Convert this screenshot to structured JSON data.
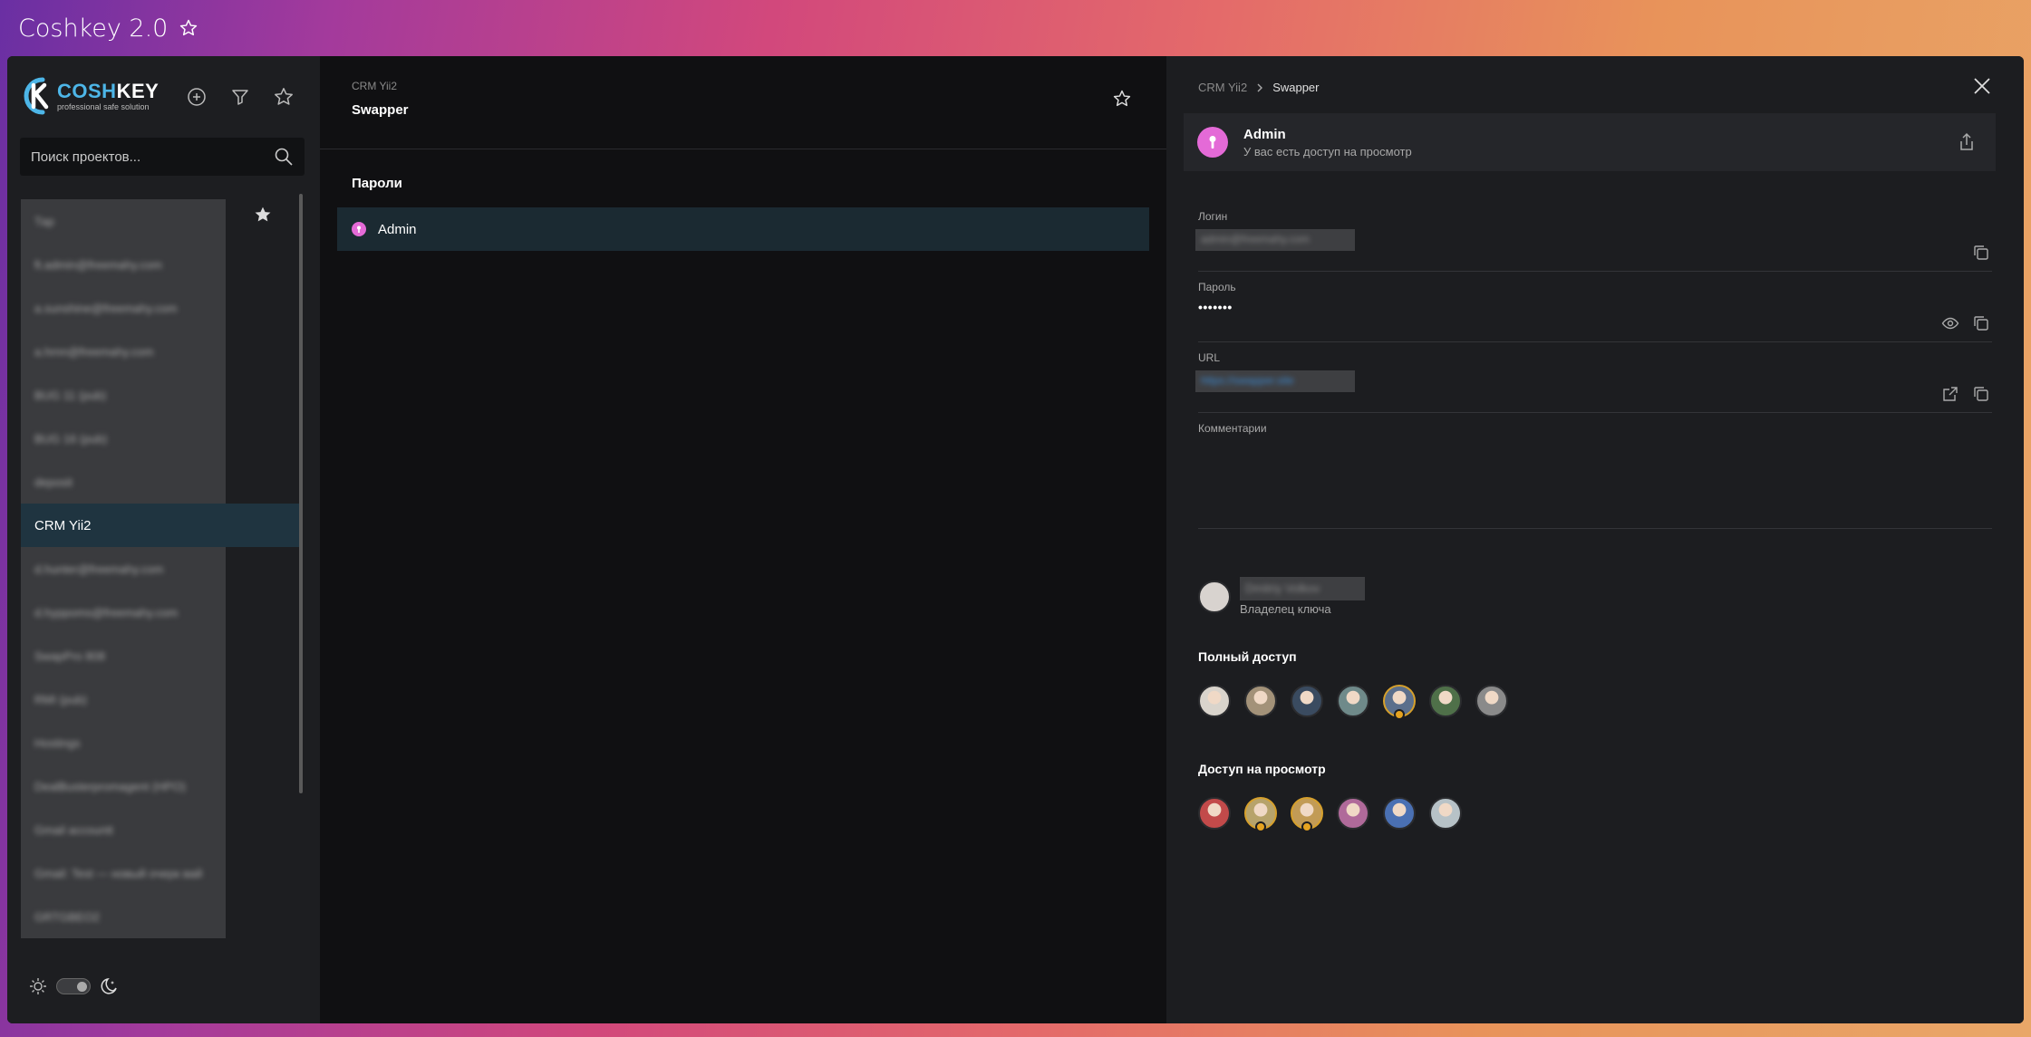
{
  "titlebar": {
    "title": "Coshkey 2.0"
  },
  "sidebar": {
    "logo": {
      "name_accent": "COSH",
      "name_rest": "KEY",
      "tagline": "professional safe solution"
    },
    "search": {
      "placeholder": "Поиск проектов..."
    },
    "projects": [
      {
        "label": "Тар",
        "blurred": true,
        "active": false
      },
      {
        "label": "ft.admin@freemahy.com",
        "blurred": true,
        "active": false
      },
      {
        "label": "a.sunshine@freemahy.com",
        "blurred": true,
        "active": false
      },
      {
        "label": "a.hrnn@freemahy.com",
        "blurred": true,
        "active": false
      },
      {
        "label": "BUG 11 (pub)",
        "blurred": true,
        "active": false
      },
      {
        "label": "BUG 16 (pub)",
        "blurred": true,
        "active": false
      },
      {
        "label": "deposit",
        "blurred": true,
        "active": false
      },
      {
        "label": "CRM Yii2",
        "blurred": false,
        "active": true
      },
      {
        "label": "d.hunter@freemahy.com",
        "blurred": true,
        "active": false
      },
      {
        "label": "d.hyppoms@freemahy.com",
        "blurred": true,
        "active": false
      },
      {
        "label": "SwapPro 808",
        "blurred": true,
        "active": false
      },
      {
        "label": "RMI (pub)",
        "blurred": true,
        "active": false
      },
      {
        "label": "Hostings",
        "blurred": true,
        "active": false
      },
      {
        "label": "DealBusterpromagent (HPO)",
        "blurred": true,
        "active": false
      },
      {
        "label": "Gmail accountt",
        "blurred": true,
        "active": false
      },
      {
        "label": "Gmail: Test — новый очерк вай",
        "blurred": true,
        "active": false
      },
      {
        "label": "GRTGBEO2",
        "blurred": true,
        "active": false
      }
    ]
  },
  "middle": {
    "breadcrumb": "CRM Yii2",
    "title": "Swapper",
    "section": "Пароли",
    "passwords": [
      {
        "name": "Admin"
      }
    ]
  },
  "detail": {
    "breadcrumb": {
      "parent": "CRM Yii2",
      "current": "Swapper"
    },
    "entry": {
      "name": "Admin",
      "access": "У вас есть доступ на просмотр"
    },
    "fields": {
      "login": {
        "label": "Логин",
        "value": "admin@freemahy.com"
      },
      "password": {
        "label": "Пароль",
        "value": "•••••••"
      },
      "url": {
        "label": "URL",
        "value": "https://swapper.site"
      },
      "comments": {
        "label": "Комментарии",
        "value": ""
      }
    },
    "owner": {
      "name": "Dmitriy Volkov",
      "role": "Владелец ключа"
    },
    "full_access": {
      "title": "Полный доступ",
      "avatars": [
        {
          "color": "#d9d4cc",
          "badge": false
        },
        {
          "color": "#a39279",
          "badge": false
        },
        {
          "color": "#3a4b60",
          "badge": false
        },
        {
          "color": "#6f8a8a",
          "badge": false
        },
        {
          "color": "#5b6f8c",
          "badge": true
        },
        {
          "color": "#4f7049",
          "badge": false
        },
        {
          "color": "#8a8a8a",
          "badge": false
        }
      ]
    },
    "view_access": {
      "title": "Доступ на просмотр",
      "avatars": [
        {
          "color": "#c24a4a",
          "badge": false
        },
        {
          "color": "#b7a36b",
          "badge": true
        },
        {
          "color": "#c29b56",
          "badge": true
        },
        {
          "color": "#b06a9a",
          "badge": false
        },
        {
          "color": "#4a70b3",
          "badge": false
        },
        {
          "color": "#b7c2c7",
          "badge": false
        }
      ]
    }
  },
  "colors": {
    "accent": "#4db6e8",
    "key_icon": "#e46ad7",
    "active_row": "#1b2a32"
  }
}
